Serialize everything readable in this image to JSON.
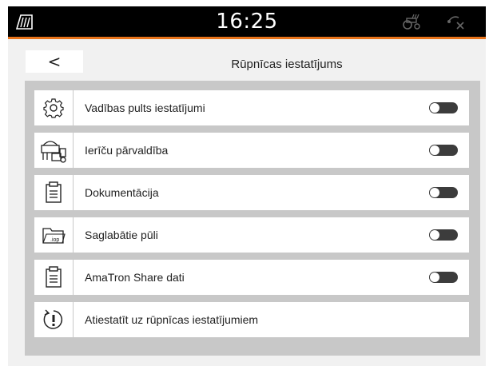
{
  "status_bar": {
    "time": "16:25",
    "left_icon": "field-boundary-icon",
    "right_icons": [
      "tractor-signal-icon",
      "gps-disconnected-icon"
    ],
    "accent_color": "#e8731a"
  },
  "header": {
    "back_label": "<",
    "title": "Rūpnīcas iestatījums"
  },
  "items": [
    {
      "label": "Vadības pults iestatījumi",
      "icon": "gear-icon",
      "toggle": "off"
    },
    {
      "label": "Ierīču pārvaldība",
      "icon": "machine-management-icon",
      "toggle": "off"
    },
    {
      "label": "Dokumentācija",
      "icon": "clipboard-icon",
      "toggle": "off"
    },
    {
      "label": "Saglabātie pūli",
      "icon": "iop-folder-icon",
      "toggle": "off"
    },
    {
      "label": "AmaTron Share dati",
      "icon": "clipboard-icon",
      "toggle": "off"
    },
    {
      "label": "Atiestatīt uz rūpnīcas iestatījumiem",
      "icon": "reset-icon"
    }
  ]
}
